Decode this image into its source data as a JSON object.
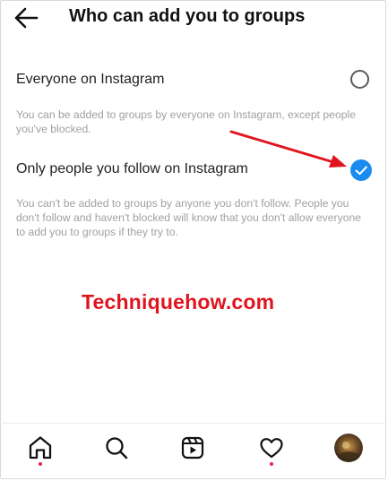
{
  "header": {
    "title": "Who can add you to groups",
    "back_icon": "back-arrow-icon"
  },
  "options": [
    {
      "label": "Everyone on Instagram",
      "description": "You can be added to groups by everyone on Instagram, except people you've blocked.",
      "selected": false
    },
    {
      "label": "Only people you follow on Instagram",
      "description": "You can't be added to groups by anyone you don't follow. People you don't follow and haven't blocked will know that you don't allow everyone to add you to groups if they try to.",
      "selected": true
    }
  ],
  "watermark": "Techniquehow.com",
  "colors": {
    "accent": "#1a8cf0",
    "annotation": "#e0141e",
    "notification_dot": "#ee2244"
  },
  "bottom_nav": {
    "items": [
      {
        "name": "home-icon",
        "notification": true
      },
      {
        "name": "search-icon",
        "notification": false
      },
      {
        "name": "reels-icon",
        "notification": false
      },
      {
        "name": "heart-icon",
        "notification": true
      },
      {
        "name": "profile-avatar",
        "notification": false
      }
    ]
  }
}
